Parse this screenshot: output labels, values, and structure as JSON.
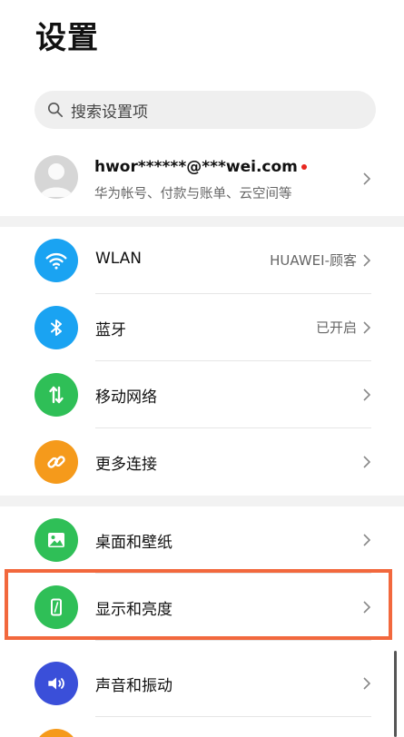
{
  "header": {
    "title": "设置"
  },
  "search": {
    "placeholder": "搜索设置项"
  },
  "account": {
    "name": "hwor******@***wei.com",
    "subtitle": "华为帐号、付款与账单、云空间等"
  },
  "colors": {
    "wlan": "#1aa3f2",
    "bluetooth": "#1aa3f2",
    "mobile_network": "#2fbf57",
    "more_connections": "#f59a1b",
    "wallpaper": "#2fbf57",
    "display": "#2fbf57",
    "sound": "#3a4fd9",
    "highlight": "#f2683d",
    "badge": "#e8261f"
  },
  "items": [
    {
      "label": "WLAN",
      "value": "HUAWEI-顾客",
      "icon": "wifi-icon"
    },
    {
      "label": "蓝牙",
      "value": "已开启",
      "icon": "bluetooth-icon"
    },
    {
      "label": "移动网络",
      "value": "",
      "icon": "mobile-data-icon"
    },
    {
      "label": "更多连接",
      "value": "",
      "icon": "link-icon"
    },
    {
      "label": "桌面和壁纸",
      "value": "",
      "icon": "image-icon"
    },
    {
      "label": "显示和亮度",
      "value": "",
      "icon": "phone-brightness-icon"
    },
    {
      "label": "声音和振动",
      "value": "",
      "icon": "speaker-icon"
    }
  ]
}
